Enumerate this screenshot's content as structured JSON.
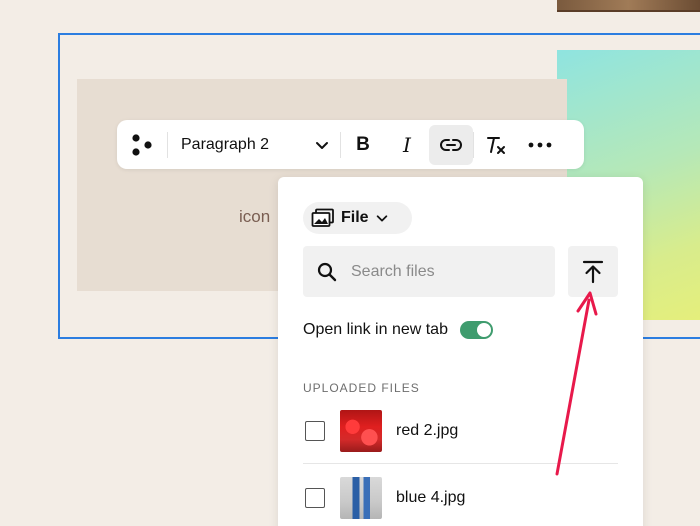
{
  "canvas": {
    "text_icon": "icon"
  },
  "toolbar": {
    "paragraph_style": "Paragraph 2",
    "bold_label": "B",
    "italic_label": "I",
    "clear_label": "T",
    "more_label": "•••"
  },
  "link_panel": {
    "source_label": "File",
    "search_placeholder": "Search files",
    "open_new_tab_label": "Open link in new tab",
    "open_new_tab_enabled": true,
    "section_label": "UPLOADED FILES",
    "files": [
      {
        "name": "red 2.jpg",
        "checked": false
      },
      {
        "name": "blue 4.jpg",
        "checked": false
      }
    ]
  },
  "colors": {
    "selection": "#2b7de0",
    "toggle_on": "#3f9c6e",
    "annotation_arrow": "#e8194b"
  }
}
